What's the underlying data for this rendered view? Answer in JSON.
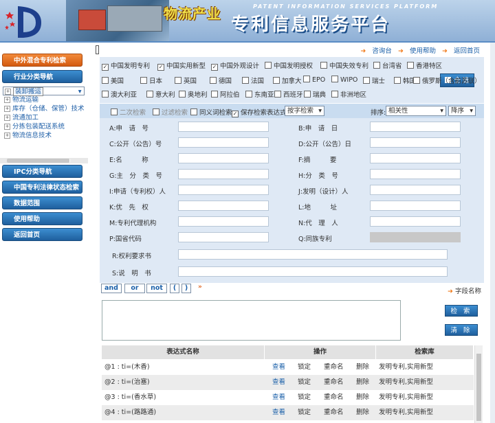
{
  "banner": {
    "title_left": "物流产业",
    "title_en": "PATENT INFORMATION SERVICES PLATFORM",
    "title_main": "专利信息服务平台"
  },
  "sidebar": {
    "top_buttons": [
      "中外混合专利检索",
      "行业分类导航"
    ],
    "tree": [
      "装卸搬运",
      "物流运输",
      "库存（仓储、保管）技术",
      "流通加工",
      "分拣包装配送系统",
      "物流信息技术"
    ],
    "bottom_buttons": [
      "IPC分类导航",
      "中国专利法律状态检索",
      "数据范围",
      "使用帮助",
      "返回首页"
    ]
  },
  "toplinks": [
    "咨询台",
    "使用帮助",
    "返回首页"
  ],
  "databases": [
    {
      "label": "中国发明专利",
      "checked": true
    },
    {
      "label": "中国实用新型",
      "checked": true
    },
    {
      "label": "中国外观设计",
      "checked": true
    },
    {
      "label": "中国发明授权",
      "checked": false
    },
    {
      "label": "中国失效专利",
      "checked": false
    },
    {
      "label": "台湾省",
      "checked": false
    },
    {
      "label": "香港特区",
      "checked": false
    },
    {
      "label": "美国",
      "checked": false
    },
    {
      "label": "日本",
      "checked": false
    },
    {
      "label": "英国",
      "checked": false
    },
    {
      "label": "德国",
      "checked": false
    },
    {
      "label": "法国",
      "checked": false
    },
    {
      "label": "加拿大",
      "checked": false
    },
    {
      "label": "EPO",
      "checked": false
    },
    {
      "label": "WIPO",
      "checked": false
    },
    {
      "label": "瑞士",
      "checked": false
    },
    {
      "label": "韩国",
      "checked": false
    },
    {
      "label": "俄罗斯（含前苏联）",
      "checked": false
    },
    {
      "label": "澳大利亚",
      "checked": false
    },
    {
      "label": "意大利",
      "checked": false
    },
    {
      "label": "奥地利",
      "checked": false
    },
    {
      "label": "阿拉伯",
      "checked": false
    },
    {
      "label": "东南亚",
      "checked": false
    },
    {
      "label": "西班牙",
      "checked": false
    },
    {
      "label": "瑞典",
      "checked": false
    },
    {
      "label": "非洲地区",
      "checked": false
    }
  ],
  "select_all": "全 选",
  "options": {
    "secondary": "二次检索",
    "filter": "过滤检索",
    "synonym": "同义词检索",
    "save": "保存检索表达式",
    "save_mode": "按字检索",
    "sort_label": "排序:",
    "sort_by": "相关性",
    "sort_order": "降序"
  },
  "fields": [
    [
      "A:申　请　号",
      "B:申　请　日"
    ],
    [
      "C:公开（公告）号",
      "D:公开（公告）日"
    ],
    [
      "E:名　　　称",
      "F:摘　　　要"
    ],
    [
      "G:主　分　类　号",
      "H:分　类　号"
    ],
    [
      "I:申请（专利权）人",
      "J:发明（设计）人"
    ],
    [
      "K:优　先　权",
      "L:地　　　址"
    ],
    [
      "M:专利代理机构",
      "N:代　理　人"
    ],
    [
      "P:国省代码",
      "Q:同族专利"
    ]
  ],
  "wide_fields": [
    "R:权利要求书",
    "S:说　明　书"
  ],
  "operators": [
    "and",
    "or",
    "not",
    "(",
    ")"
  ],
  "field_name_link": "字段名称",
  "buttons": {
    "search": "检 索",
    "clear": "清 除"
  },
  "table": {
    "headers": [
      "表达式名称",
      "操作",
      "检索库"
    ],
    "actions": [
      "查看",
      "锁定",
      "重命名",
      "删除"
    ],
    "rows": [
      {
        "name": "@1 : ti=(木香)",
        "db": "发明专利,实用新型"
      },
      {
        "name": "@2 : ti=(治塞)",
        "db": "发明专利,实用新型"
      },
      {
        "name": "@3 : ti=(香水草)",
        "db": "发明专利,实用新型"
      },
      {
        "name": "@4 : ti=(路路通)",
        "db": "发明专利,实用新型"
      }
    ]
  }
}
